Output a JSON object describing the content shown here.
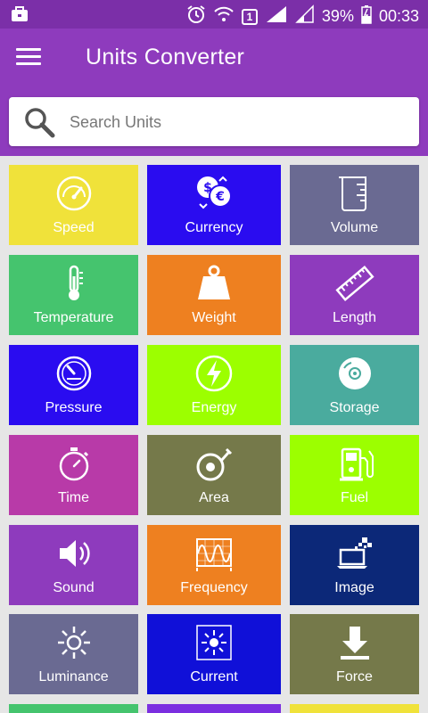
{
  "status_bar": {
    "battery": "39%",
    "time": "00:33",
    "sim_badge": "1"
  },
  "app_bar": {
    "title": "Units Converter"
  },
  "search": {
    "placeholder": "Search Units"
  },
  "tiles": [
    {
      "label": "Speed",
      "color": "#f0e23a",
      "icon": "speedometer-icon"
    },
    {
      "label": "Currency",
      "color": "#2a0cf0",
      "icon": "currency-icon"
    },
    {
      "label": "Volume",
      "color": "#6a6a92",
      "icon": "beaker-icon"
    },
    {
      "label": "Temperature",
      "color": "#45c46e",
      "icon": "thermometer-icon"
    },
    {
      "label": "Weight",
      "color": "#ee8020",
      "icon": "weight-icon"
    },
    {
      "label": "Length",
      "color": "#8e3bbd",
      "icon": "ruler-icon"
    },
    {
      "label": "Pressure",
      "color": "#2a0cf0",
      "icon": "gauge-icon"
    },
    {
      "label": "Energy",
      "color": "#9cff00",
      "icon": "lightning-icon"
    },
    {
      "label": "Storage",
      "color": "#4aab9e",
      "icon": "disc-icon"
    },
    {
      "label": "Time",
      "color": "#b83aa8",
      "icon": "stopwatch-icon"
    },
    {
      "label": "Area",
      "color": "#75794a",
      "icon": "tape-measure-icon"
    },
    {
      "label": "Fuel",
      "color": "#9cff00",
      "icon": "fuel-pump-icon"
    },
    {
      "label": "Sound",
      "color": "#8e3bbd",
      "icon": "speaker-icon"
    },
    {
      "label": "Frequency",
      "color": "#ee8020",
      "icon": "waveform-icon"
    },
    {
      "label": "Image",
      "color": "#0c2878",
      "icon": "laptop-pixels-icon"
    },
    {
      "label": "Luminance",
      "color": "#6a6a92",
      "icon": "sun-icon"
    },
    {
      "label": "Current",
      "color": "#1010d8",
      "icon": "current-icon"
    },
    {
      "label": "Force",
      "color": "#75794a",
      "icon": "download-arrow-icon"
    }
  ],
  "partial_row_colors": [
    "#45c46e",
    "#7b2fe0",
    "#f0e23a"
  ]
}
